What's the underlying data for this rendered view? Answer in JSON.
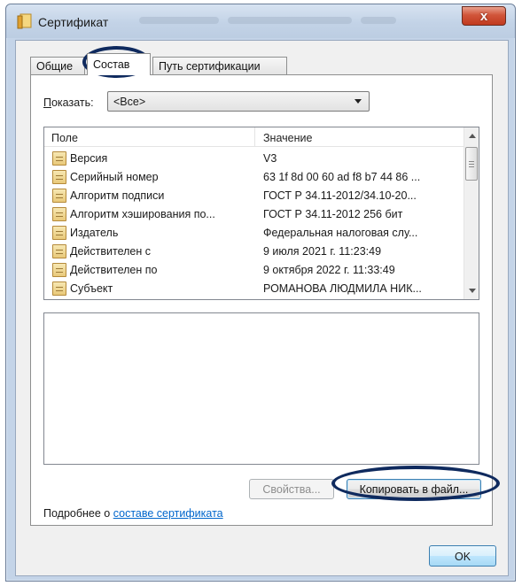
{
  "window": {
    "title": "Сертификат",
    "close_glyph": "x"
  },
  "tabs": [
    {
      "label": "Общие"
    },
    {
      "label": "Состав",
      "active": true
    },
    {
      "label": "Путь сертификации"
    }
  ],
  "show": {
    "label_accel": "П",
    "label_rest": "оказать:",
    "selected": "<Все>"
  },
  "fields_list": {
    "columns": {
      "field": "Поле",
      "value": "Значение"
    },
    "rows": [
      {
        "field": "Версия",
        "value": "V3"
      },
      {
        "field": "Серийный номер",
        "value": "63 1f 8d 00 60 ad f8 b7 44 86 ..."
      },
      {
        "field": "Алгоритм подписи",
        "value": "ГОСТ Р 34.11-2012/34.10-20..."
      },
      {
        "field": "Алгоритм хэширования по...",
        "value": "ГОСТ Р 34.11-2012 256 бит"
      },
      {
        "field": "Издатель",
        "value": "Федеральная налоговая слу..."
      },
      {
        "field": "Действителен с",
        "value": "9 июля 2021 г. 11:23:49"
      },
      {
        "field": "Действителен по",
        "value": "9 октября 2022 г. 11:33:49"
      },
      {
        "field": "Субъект",
        "value": "РОМАНОВА ЛЮДМИЛА НИК..."
      }
    ]
  },
  "buttons": {
    "properties": "Свойства...",
    "copy_to_file": "Копировать в файл...",
    "ok": "OK"
  },
  "details": {
    "prefix": "Подробнее о ",
    "link": "составе сертификата"
  },
  "colors": {
    "annotation": "#0f2a5e",
    "link": "#0066cc",
    "titlebar": "#c3d3e7"
  }
}
